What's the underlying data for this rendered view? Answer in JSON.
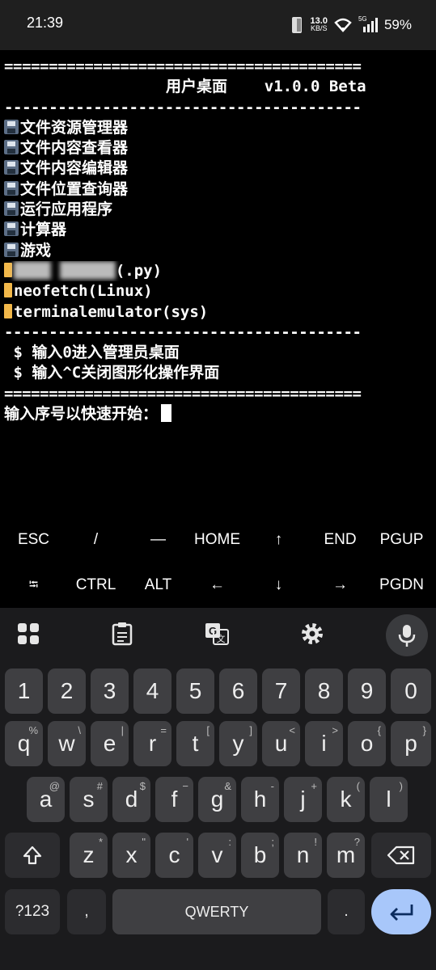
{
  "status_bar": {
    "time": "21:39",
    "net_speed_value": "13.0",
    "net_speed_unit": "KB/S",
    "network_type": "5G",
    "battery": "59%"
  },
  "terminal": {
    "rule_double": "========================================",
    "rule_single": "----------------------------------------",
    "title": "用户桌面    v1.0.0 Beta",
    "menu_items": [
      {
        "icon": "floppy-disk-icon",
        "label": "文件资源管理器"
      },
      {
        "icon": "floppy-disk-icon",
        "label": "文件内容查看器"
      },
      {
        "icon": "floppy-disk-icon",
        "label": "文件内容编辑器"
      },
      {
        "icon": "floppy-disk-icon",
        "label": "文件位置查询器"
      },
      {
        "icon": "floppy-disk-icon",
        "label": "运行应用程序"
      },
      {
        "icon": "floppy-disk-icon",
        "label": "计算器"
      },
      {
        "icon": "floppy-disk-icon",
        "label": "游戏"
      },
      {
        "icon": "folder-icon",
        "label_hidden": "████ ██████",
        "label": "(.py)"
      },
      {
        "icon": "folder-icon",
        "label": "neofetch(Linux)"
      },
      {
        "icon": "folder-icon",
        "label": "terminalemulator(sys)"
      }
    ],
    "hints": [
      " $ 输入0进入管理员桌面",
      " $ 输入^C关闭图形化操作界面"
    ],
    "prompt": "输入序号以快速开始："
  },
  "extra_keys": {
    "row1": [
      "ESC",
      "/",
      "—",
      "HOME",
      "↑",
      "END",
      "PGUP"
    ],
    "row2": [
      "⭾",
      "CTRL",
      "ALT",
      "←",
      "↓",
      "→",
      "PGDN"
    ]
  },
  "keyboard": {
    "toolbar": [
      "apps-grid-icon",
      "clipboard-icon",
      "translate-icon",
      "settings-gear-icon",
      "microphone-icon"
    ],
    "numbers": [
      "1",
      "2",
      "3",
      "4",
      "5",
      "6",
      "7",
      "8",
      "9",
      "0"
    ],
    "row1": [
      [
        "q",
        "%"
      ],
      [
        "w",
        "\\"
      ],
      [
        "e",
        "|"
      ],
      [
        "r",
        "="
      ],
      [
        "t",
        "["
      ],
      [
        "y",
        "]"
      ],
      [
        "u",
        "<"
      ],
      [
        "i",
        ">"
      ],
      [
        "o",
        "{"
      ],
      [
        "p",
        "}"
      ]
    ],
    "row2": [
      [
        "a",
        "@"
      ],
      [
        "s",
        "#"
      ],
      [
        "d",
        "$"
      ],
      [
        "f",
        "−"
      ],
      [
        "g",
        "&"
      ],
      [
        "h",
        "-"
      ],
      [
        "j",
        "+"
      ],
      [
        "k",
        "("
      ],
      [
        "l",
        ")"
      ]
    ],
    "row3": [
      [
        "z",
        "*"
      ],
      [
        "x",
        "\""
      ],
      [
        "c",
        "'"
      ],
      [
        "v",
        ":"
      ],
      [
        "b",
        ";"
      ],
      [
        "n",
        "!"
      ],
      [
        "m",
        "?"
      ]
    ],
    "symbols_label": "?123",
    "comma": ",",
    "space_label": "QWERTY",
    "period": "."
  }
}
